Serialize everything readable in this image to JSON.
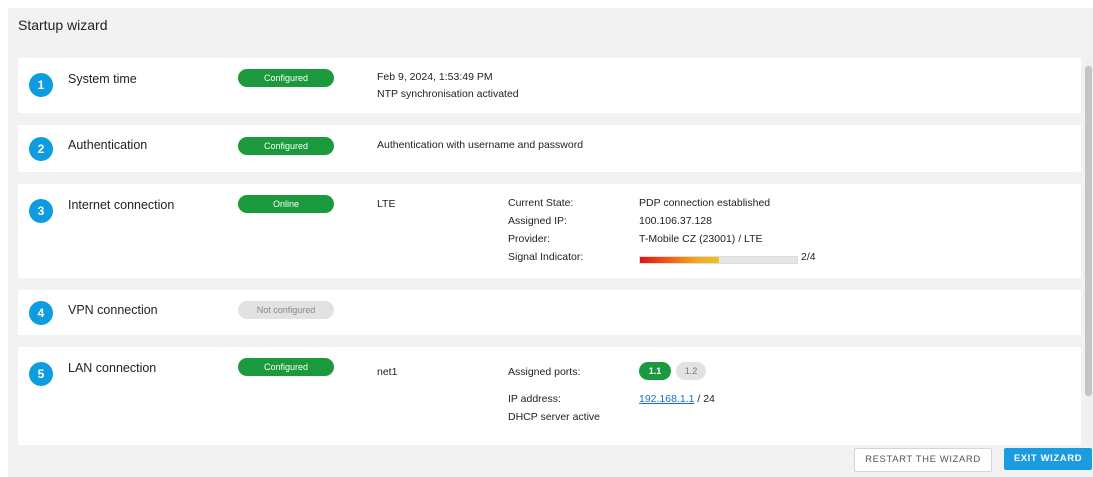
{
  "title": "Startup wizard",
  "steps": [
    {
      "number": "1",
      "title": "System time",
      "status": "Configured",
      "details": [
        "Feb 9, 2024, 1:53:49 PM",
        "NTP synchronisation activated"
      ]
    },
    {
      "number": "2",
      "title": "Authentication",
      "status": "Configured",
      "details": [
        "Authentication with username and password"
      ]
    },
    {
      "number": "3",
      "title": "Internet connection",
      "status": "Online",
      "interface": "LTE",
      "labels": {
        "state": "Current State:",
        "ip": "Assigned IP:",
        "provider": "Provider:",
        "signal": "Signal Indicator:"
      },
      "values": {
        "state": "PDP connection established",
        "ip": "100.106.37.128",
        "provider": "T-Mobile CZ (23001) / LTE",
        "signal_text": "2/4",
        "signal_level": 0.5
      }
    },
    {
      "number": "4",
      "title": "VPN connection",
      "status": "Not configured"
    },
    {
      "number": "5",
      "title": "LAN connection",
      "status": "Configured",
      "interface": "net1",
      "labels": {
        "ports": "Assigned ports:",
        "ip": "IP address:",
        "dhcp": "DHCP server active"
      },
      "ports": [
        "1.1",
        "1.2"
      ],
      "ip_address": "192.168.1.1",
      "prefix": " / 24"
    }
  ],
  "buttons": {
    "restart": "RESTART THE WIZARD",
    "exit": "EXIT WIZARD"
  },
  "colors": {
    "accent": "#0d9ce0",
    "success": "#1a9a3c",
    "inactive": "#e2e2e2"
  }
}
